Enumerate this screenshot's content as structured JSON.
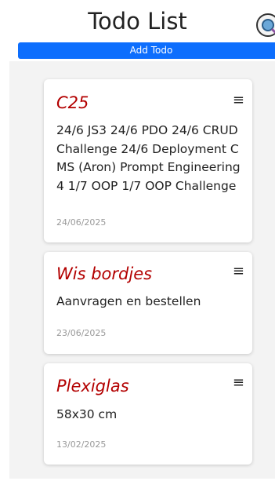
{
  "header": {
    "title": "Todo List",
    "search_icon": "search-icon"
  },
  "add_button": {
    "label": "Add Todo",
    "color": "#0d6efd"
  },
  "todos": [
    {
      "title": "C25",
      "text": "24/6 JS3 24/6 PDO 24/6 CRUD Challenge 24/6 Deployment C MS (Aron) Prompt Engineering 4 1/7 OOP 1/7 OOP Challenge",
      "date": "24/06/2025",
      "menu_icon": "≡"
    },
    {
      "title": "Wis bordjes",
      "text": "Aanvragen en bestellen",
      "date": "23/06/2025",
      "menu_icon": "≡"
    },
    {
      "title": "Plexiglas",
      "text": "58x30 cm",
      "date": "13/02/2025",
      "menu_icon": "≡"
    }
  ],
  "colors": {
    "title": "#b30000",
    "date": "#999999"
  }
}
